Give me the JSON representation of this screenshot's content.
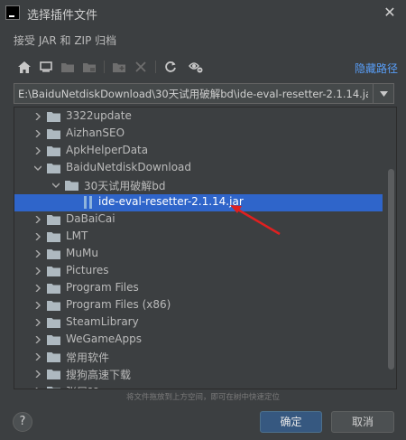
{
  "window": {
    "title": "选择插件文件",
    "subtitle": "接受 JAR 和 ZIP 归档"
  },
  "toolbar": {
    "buttons": [
      "home-icon",
      "desktop-icon",
      "project-icon",
      "module-icon",
      "new-folder-icon",
      "delete-icon",
      "refresh-icon",
      "show-hidden-icon"
    ],
    "hide_path_label": "隐藏路径"
  },
  "path": {
    "value": "E:\\BaiduNetdiskDownload\\30天试用破解bd\\ide-eval-resetter-2.1.14.jar"
  },
  "tree": {
    "items": [
      {
        "label": "3322update",
        "level": 0,
        "expanded": false,
        "type": "folder"
      },
      {
        "label": "AizhanSEO",
        "level": 0,
        "expanded": false,
        "type": "folder"
      },
      {
        "label": "ApkHelperData",
        "level": 0,
        "expanded": false,
        "type": "folder"
      },
      {
        "label": "BaiduNetdiskDownload",
        "level": 0,
        "expanded": true,
        "type": "folder"
      },
      {
        "label": "30天试用破解bd",
        "level": 1,
        "expanded": true,
        "type": "folder"
      },
      {
        "label": "ide-eval-resetter-2.1.14.jar",
        "level": 2,
        "expanded": false,
        "type": "file",
        "selected": true
      },
      {
        "label": "DaBaiCai",
        "level": 0,
        "expanded": false,
        "type": "folder"
      },
      {
        "label": "LMT",
        "level": 0,
        "expanded": false,
        "type": "folder"
      },
      {
        "label": "MuMu",
        "level": 0,
        "expanded": false,
        "type": "folder"
      },
      {
        "label": "Pictures",
        "level": 0,
        "expanded": false,
        "type": "folder"
      },
      {
        "label": "Program Files",
        "level": 0,
        "expanded": false,
        "type": "folder"
      },
      {
        "label": "Program Files (x86)",
        "level": 0,
        "expanded": false,
        "type": "folder"
      },
      {
        "label": "SteamLibrary",
        "level": 0,
        "expanded": false,
        "type": "folder"
      },
      {
        "label": "WeGameApps",
        "level": 0,
        "expanded": false,
        "type": "folder"
      },
      {
        "label": "常用软件",
        "level": 0,
        "expanded": false,
        "type": "folder"
      },
      {
        "label": "搜狗高速下载",
        "level": 0,
        "expanded": false,
        "type": "folder"
      },
      {
        "label": "张居??",
        "level": 0,
        "expanded": false,
        "type": "folder"
      }
    ]
  },
  "hint": "将文件拖放到上方空间，即可在树中快速定位",
  "buttons": {
    "help": "?",
    "ok": "确定",
    "cancel": "取消"
  },
  "colors": {
    "selection": "#2f65ca",
    "link": "#589df6",
    "primary_button": "#365880",
    "annotation_arrow": "#e02020"
  }
}
